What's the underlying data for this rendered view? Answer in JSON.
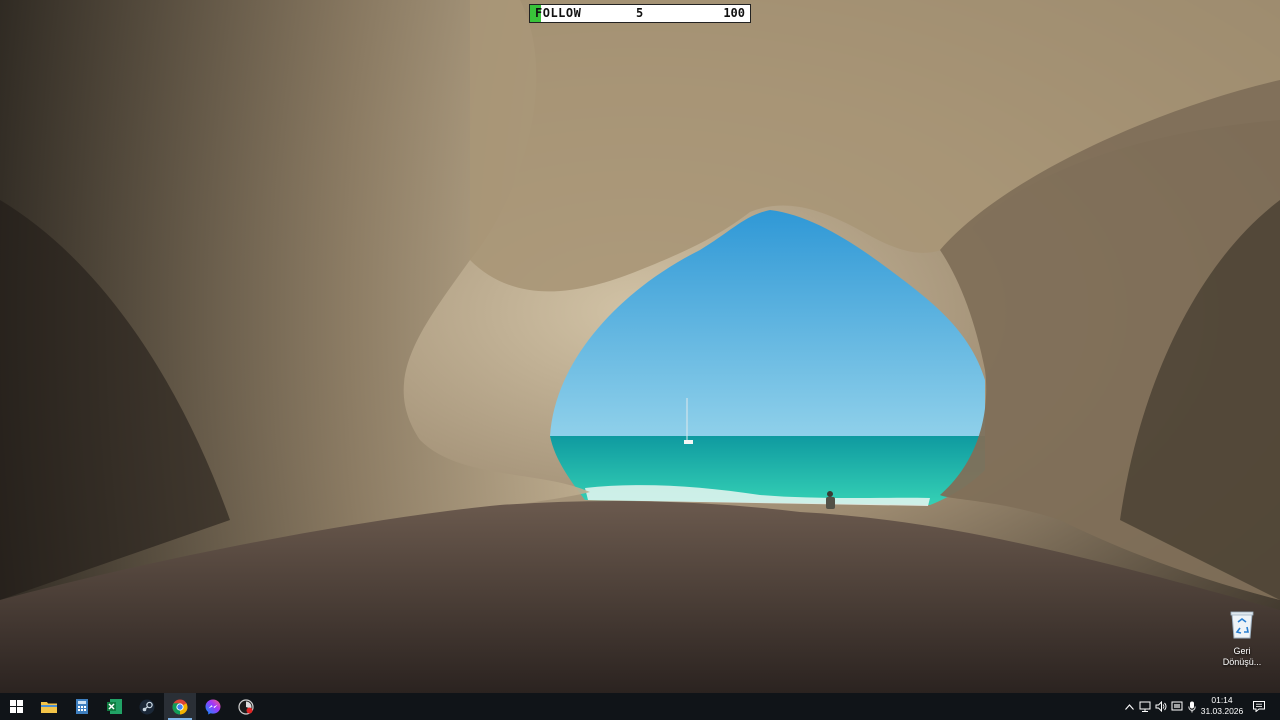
{
  "goal_bar": {
    "label": "FOLLOW",
    "current": "5",
    "target": "100",
    "progress_fraction": 0.05,
    "fill_color": "#39c33a"
  },
  "desktop": {
    "icons": [
      {
        "icon": "recycle-bin-icon",
        "label_line1": "Geri",
        "label_line2": "Dönüşü..."
      }
    ]
  },
  "taskbar": {
    "start_icon": "windows-logo-icon",
    "pinned": [
      {
        "name": "file-explorer",
        "icon": "folder-icon"
      },
      {
        "name": "calculator",
        "icon": "calculator-icon"
      },
      {
        "name": "excel",
        "icon": "excel-icon"
      },
      {
        "name": "steam",
        "icon": "steam-icon"
      },
      {
        "name": "chrome",
        "icon": "chrome-icon",
        "active": true
      },
      {
        "name": "messenger",
        "icon": "messenger-icon"
      },
      {
        "name": "recorder",
        "icon": "record-app-icon"
      }
    ],
    "tray_icons": [
      "chevron-up-icon",
      "network-icon",
      "volume-icon",
      "display-icon",
      "microphone-icon"
    ],
    "clock": {
      "time": "01:14",
      "date": "31.03.2026"
    },
    "notification_icon": "notification-icon"
  },
  "colors": {
    "taskbar_bg": "#101418",
    "sky": "#3fa8dc",
    "sea": "#1fb9a6"
  }
}
